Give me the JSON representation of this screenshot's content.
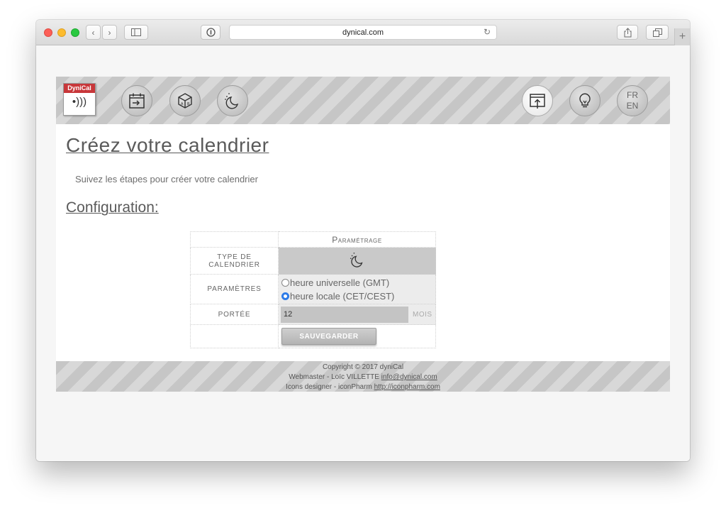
{
  "browser": {
    "url": "dynical.com",
    "reload_icon": "↻",
    "back_icon": "‹",
    "forward_icon": "›",
    "new_tab": "+"
  },
  "header": {
    "logo_text": "DyniCal",
    "logo_symbol": "•)))",
    "lang_fr": "FR",
    "lang_en": "EN",
    "icons": [
      "calendar-import-icon",
      "cube-letters-icon",
      "moon-icon",
      "upload-window-icon",
      "lightbulb-icon"
    ]
  },
  "main": {
    "title": "Créez votre calendrier",
    "subtitle": "Suivez les étapes pour créer votre calendrier",
    "config_heading": "Configuration:"
  },
  "form": {
    "header": "Paramétrage",
    "type_label": "type de calendrier",
    "params_label": "paramètres",
    "radio1": "heure universelle (GMT)",
    "radio2": "heure locale (CET/CEST)",
    "selected_radio": 2,
    "portee_label": "portée",
    "portee_value": "12",
    "portee_unit": "mois",
    "save_label": "SAUVEGARDER"
  },
  "footer": {
    "copyright": "Copyright © 2017 dyniCal",
    "webmaster_prefix": "Webmaster - Loïc VILLETTE ",
    "webmaster_email": "info@dynical.com",
    "icons_prefix": "Icons designer - iconPharm ",
    "icons_link": "http://iconpharm.com"
  },
  "colors": {
    "accent_radio": "#2d7be8",
    "logo_red": "#c8373a"
  }
}
